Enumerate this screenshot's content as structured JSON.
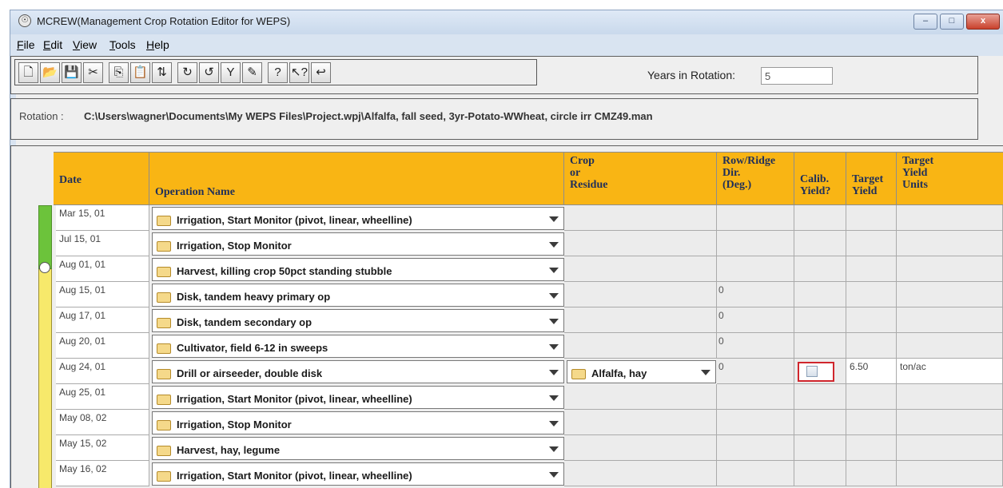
{
  "window": {
    "title": "MCREW(Management Crop Rotation Editor for WEPS)",
    "minimize": "–",
    "maximize": "□",
    "close": "x"
  },
  "menu": [
    "File",
    "Edit",
    "View",
    "Tools",
    "Help"
  ],
  "toolbar": {
    "buttons": [
      {
        "name": "new-file-icon",
        "glyph": "🗋"
      },
      {
        "name": "open-folder-icon",
        "glyph": "📂"
      },
      {
        "name": "save-icon",
        "glyph": "💾"
      },
      {
        "name": "cut-icon",
        "glyph": "✂"
      },
      {
        "name": "copy-icon",
        "glyph": "⎘"
      },
      {
        "name": "paste-icon",
        "glyph": "📋"
      },
      {
        "name": "sort-icon",
        "glyph": "⇅"
      },
      {
        "name": "redo-icon",
        "glyph": "↻"
      },
      {
        "name": "undo-icon",
        "glyph": "↺"
      },
      {
        "name": "filter-icon",
        "glyph": "Y"
      },
      {
        "name": "edit-pencil-icon",
        "glyph": "✎"
      },
      {
        "name": "help-icon",
        "glyph": "?"
      },
      {
        "name": "context-help-icon",
        "glyph": "↖?"
      },
      {
        "name": "return-arrow-icon",
        "glyph": "↩"
      }
    ],
    "years_label": "Years in Rotation:",
    "years_value": "5"
  },
  "rotation": {
    "label": "Rotation :",
    "path": "C:\\Users\\wagner\\Documents\\My WEPS Files\\Project.wpj\\Alfalfa, fall seed, 3yr-Potato-WWheat, circle irr CMZ49.man"
  },
  "table": {
    "headers": {
      "date": "Date",
      "operation": "Operation Name",
      "crop_l1": "Crop",
      "crop_l2": "or",
      "crop_l3": "Residue",
      "dir_l1": "Row/Ridge",
      "dir_l2": "Dir.",
      "dir_l3": "(Deg.)",
      "calib_l1": "Calib.",
      "calib_l2": "Yield?",
      "target_l1": "Target",
      "target_l2": "Yield",
      "units_l1": "Target",
      "units_l2": "Yield",
      "units_l3": "Units"
    },
    "rows": [
      {
        "date": "Mar 15, 01",
        "operation": "Irrigation, Start Monitor (pivot, linear, wheelline)",
        "crop": "",
        "dir": "",
        "yield": "",
        "units": ""
      },
      {
        "date": "Jul 15, 01",
        "operation": "Irrigation, Stop Monitor",
        "crop": "",
        "dir": "",
        "yield": "",
        "units": ""
      },
      {
        "date": "Aug 01, 01",
        "operation": "Harvest, killing crop 50pct standing stubble",
        "crop": "",
        "dir": "",
        "yield": "",
        "units": ""
      },
      {
        "date": "Aug 15, 01",
        "operation": "Disk, tandem heavy primary op",
        "crop": "",
        "dir": "0",
        "yield": "",
        "units": ""
      },
      {
        "date": "Aug 17, 01",
        "operation": "Disk, tandem secondary op",
        "crop": "",
        "dir": "0",
        "yield": "",
        "units": ""
      },
      {
        "date": "Aug 20, 01",
        "operation": "Cultivator, field 6-12 in sweeps",
        "crop": "",
        "dir": "0",
        "yield": "",
        "units": ""
      },
      {
        "date": "Aug 24, 01",
        "operation": "Drill or airseeder, double disk",
        "crop": "Alfalfa, hay",
        "dir": "0",
        "yield": "6.50",
        "units": "ton/ac"
      },
      {
        "date": "Aug 25, 01",
        "operation": "Irrigation, Start Monitor (pivot, linear, wheelline)",
        "crop": "",
        "dir": "",
        "yield": "",
        "units": ""
      },
      {
        "date": "May 08, 02",
        "operation": "Irrigation, Stop Monitor",
        "crop": "",
        "dir": "",
        "yield": "",
        "units": ""
      },
      {
        "date": "May 15, 02",
        "operation": "Harvest, hay, legume",
        "crop": "",
        "dir": "",
        "yield": "",
        "units": ""
      },
      {
        "date": "May 16, 02",
        "operation": "Irrigation, Start Monitor (pivot, linear, wheelline)",
        "crop": "",
        "dir": "",
        "yield": "",
        "units": ""
      }
    ]
  },
  "colors": {
    "header_bg": "#f9b514",
    "header_text": "#1f2f5a",
    "timeline_green": "#6cc33b",
    "timeline_yellow": "#f7e96b",
    "calib_highlight": "#d0262d"
  }
}
